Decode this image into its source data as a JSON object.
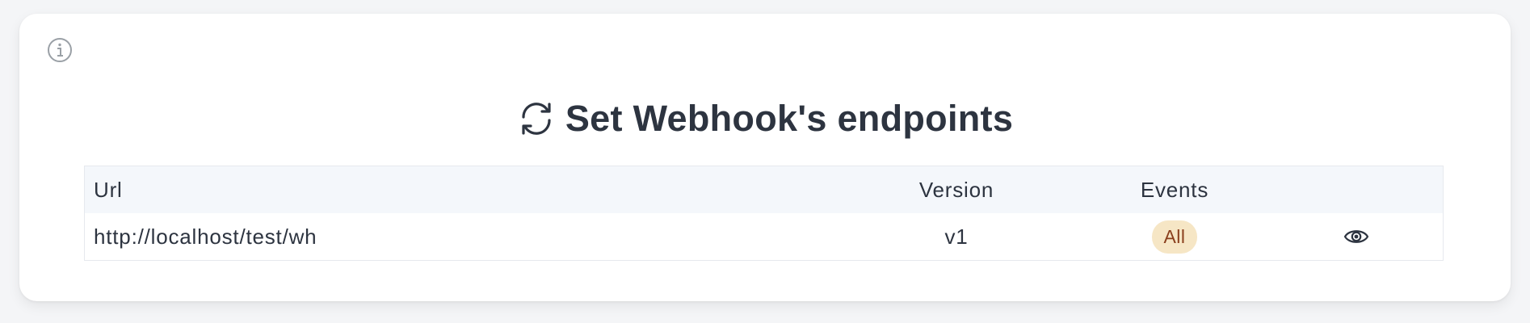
{
  "title": "Set Webhook's endpoints",
  "table": {
    "headers": {
      "url": "Url",
      "version": "Version",
      "events": "Events"
    },
    "rows": [
      {
        "url": "http://localhost/test/wh",
        "version": "v1",
        "events": "All"
      }
    ]
  },
  "icons": {
    "info": "info-icon",
    "title": "refresh-icon",
    "view": "eye-icon"
  },
  "colors": {
    "title_text": "#2d3440",
    "header_bg": "#f4f7fb",
    "badge_bg": "#f6e6c5",
    "badge_text": "#8a3f1d"
  }
}
